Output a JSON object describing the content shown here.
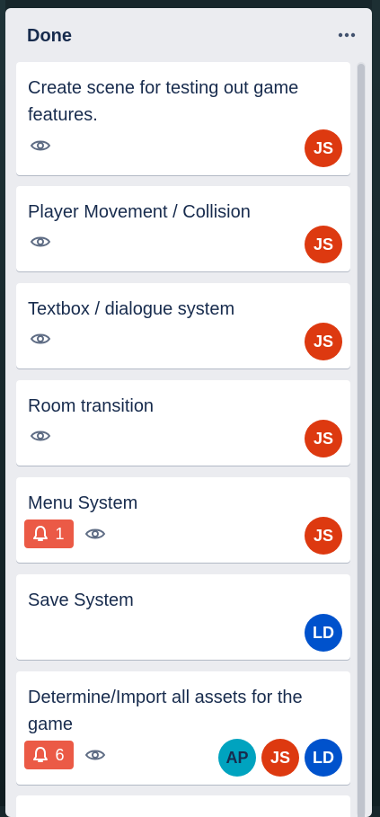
{
  "list": {
    "title": "Done"
  },
  "colors": {
    "avatar_js": "#dd3910",
    "avatar_ld": "#0052cc",
    "avatar_ap": "#00a3bf",
    "badge_red": "#eb5a46"
  },
  "cards": [
    {
      "title": "Create scene for testing out game features.",
      "members": [
        "JS"
      ]
    },
    {
      "title": "Player Movement / Collision",
      "members": [
        "JS"
      ]
    },
    {
      "title": "Textbox / dialogue system",
      "members": [
        "JS"
      ]
    },
    {
      "title": "Room transition",
      "members": [
        "JS"
      ]
    },
    {
      "title": "Menu System",
      "notifications": "1",
      "members": [
        "JS"
      ]
    },
    {
      "title": "Save System",
      "members": [
        "LD"
      ]
    },
    {
      "title": "Determine/Import all assets for the game",
      "notifications": "6",
      "members": [
        "AP",
        "JS",
        "LD"
      ]
    }
  ],
  "icons": {
    "watch": "eye-icon",
    "notification": "bell-icon",
    "menu": "more-dots-icon"
  }
}
